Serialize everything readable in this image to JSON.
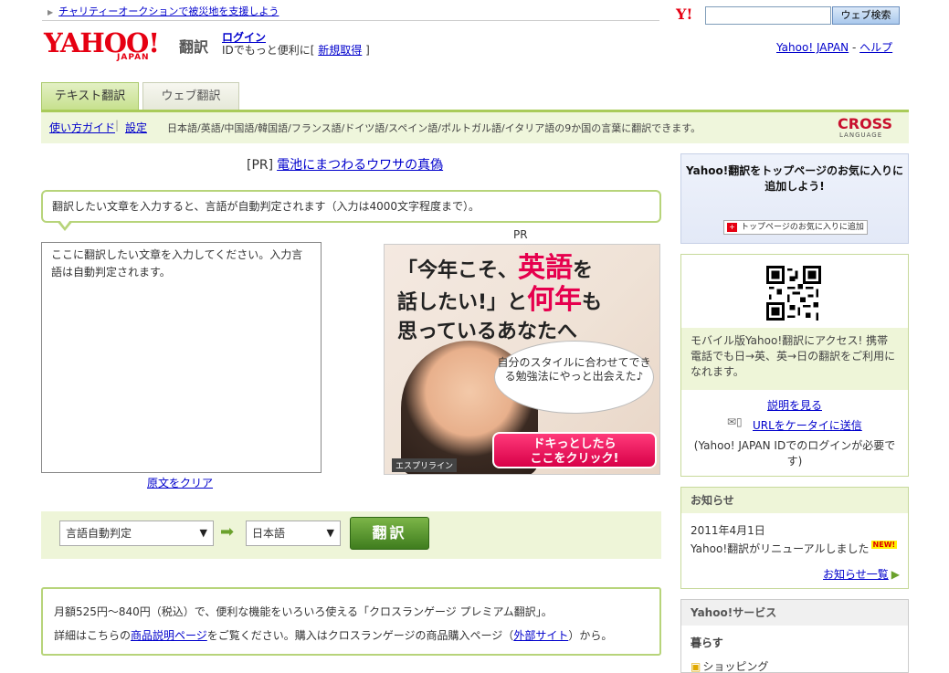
{
  "header": {
    "charity_link": "チャリティーオークションで被災地を支援しよう",
    "search_logo": "Y!",
    "search_placeholder": "",
    "search_button": "ウェブ検索",
    "logo": "YAHOO!",
    "logo_sub": "JAPAN",
    "service_name": "翻訳",
    "login": "ログイン",
    "id_prefix": "IDでもっと便利に[",
    "register": "新規取得",
    "id_suffix": "]",
    "yahoo_top": "Yahoo! JAPAN",
    "separator": "-",
    "help": "ヘルプ"
  },
  "tabs": [
    {
      "label": "テキスト翻訳",
      "active": true
    },
    {
      "label": "ウェブ翻訳",
      "active": false
    }
  ],
  "nav": {
    "guide": "使い方ガイド",
    "divider": "|",
    "settings": "設定",
    "languages": "日本語/英語/中国語/韓国語/フランス語/ドイツ語/スペイン語/ポルトガル語/イタリア語の9か国の言葉に翻訳できます。",
    "partner_logo": "CROSS",
    "partner_sub": "LANGUAGE"
  },
  "main": {
    "pr_prefix": "[PR]",
    "pr_link": "電池にまつわるウワサの真偽",
    "instruction": "翻訳したい文章を入力すると、言語が自動判定されます（入力は4000文字程度まで）。",
    "source_text": "ここに翻訳したい文章を入力してください。入力言語は自動判定されます。",
    "clear_link": "原文をクリア",
    "ad_label": "PR",
    "ad": {
      "line1_a": "「今年こそ、",
      "line1_b": "英語",
      "line1_c": "を",
      "line2_a": "話したい!」と",
      "line2_b": "何年",
      "line2_c": "も",
      "line3": "思っているあなたへ",
      "bubble": "自分のスタイルに合わせてできる勉強法にやっと出会えた♪",
      "button_line1": "ドキっとしたら",
      "button_line2": "ここをクリック!",
      "tag": "エスプリライン"
    },
    "source_lang": "言語自動判定",
    "target_lang": "日本語",
    "dropdown_arrow": "▼",
    "arrow": "➡",
    "translate_button": "翻訳",
    "premium_line1": "月額525円〜840円（税込）で、便利な機能をいろいろ使える「クロスランゲージ プレミアム翻訳」。",
    "premium_line2_a": "詳細はこちらの",
    "premium_line2_link": "商品説明ページ",
    "premium_line2_b": "をご覧ください。購入はクロスランゲージの商品購入ページ（",
    "premium_line2_link2": "外部サイト",
    "premium_line2_c": "）から。"
  },
  "sidebar": {
    "fav_title": "Yahoo!翻訳をトップページのお気に入りに追加しよう!",
    "fav_button": "トップページのお気に入りに追加",
    "fav_icon": "+",
    "mobile_text": "モバイル版Yahoo!翻訳にアクセス! 携帯電話でも日→英、英→日の翻訳をご利用になれます。",
    "mobile_how": "説明を見る",
    "mobile_url": "URLをケータイに送信",
    "mobile_note": "(Yahoo! JAPAN IDでのログインが必要です)",
    "news_head": "お知らせ",
    "news_date": "2011年4月1日",
    "news_item": "Yahoo!翻訳がリニューアルしました",
    "news_new": "NEW!",
    "news_more": "お知らせ一覧",
    "news_more_arrow": "▶",
    "services_head": "Yahoo!サービス",
    "services_sub": "暮らす",
    "services_shop": "ショッピング"
  },
  "colors": {
    "brand_red": "#e60012",
    "accent_green": "#a9cb59",
    "link_blue": "#0000cc"
  }
}
